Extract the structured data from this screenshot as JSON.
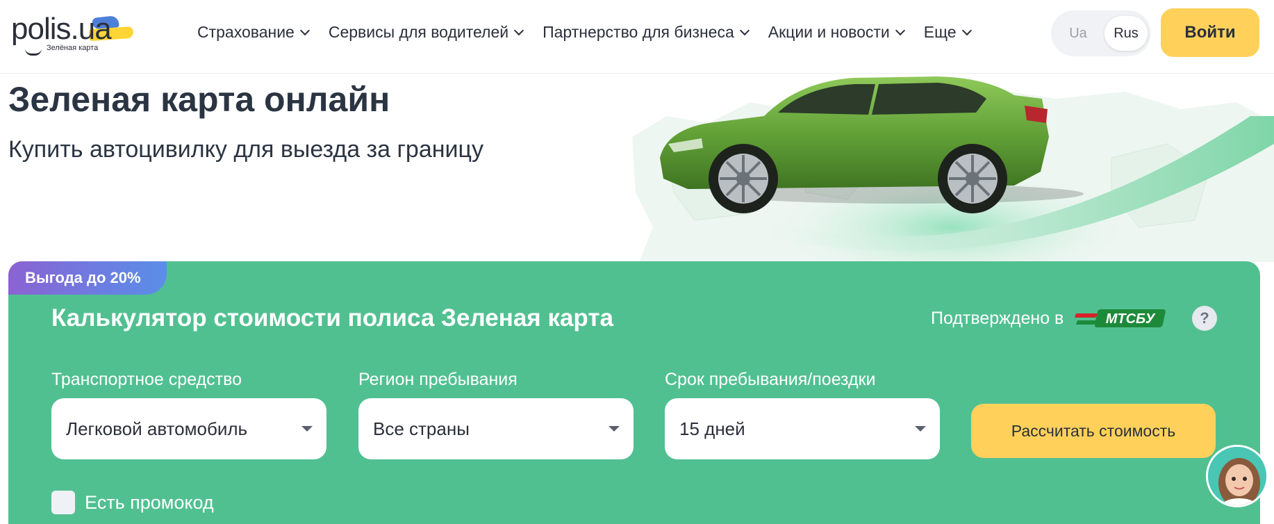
{
  "logo": {
    "brand_main": "polis",
    "brand_domain": ".ua",
    "subtitle": "Зелёная карта"
  },
  "nav": {
    "items": [
      {
        "label": "Страхование"
      },
      {
        "label": "Сервисы для водителей"
      },
      {
        "label": "Партнерство для бизнеса"
      },
      {
        "label": "Акции и новости"
      },
      {
        "label": "Еще"
      }
    ]
  },
  "lang": {
    "ua": "Ua",
    "rus": "Rus",
    "selected": "Rus"
  },
  "header": {
    "login_label": "Войти"
  },
  "hero": {
    "title": "Зеленая карта онлайн",
    "subtitle": "Купить автоцивилку для выезда за границу"
  },
  "calculator": {
    "badge": "Выгода до 20%",
    "title": "Калькулятор стоимости полиса Зеленая карта",
    "confirmed_text": "Подтверждено в",
    "confirmed_logo": "МТСБУ",
    "help_label": "?",
    "fields": [
      {
        "label": "Транспортное средство",
        "value": "Легковой автомобиль"
      },
      {
        "label": "Регион пребывания",
        "value": "Все страны"
      },
      {
        "label": "Срок пребывания/поездки",
        "value": "15 дней"
      }
    ],
    "submit_label": "Рассчитать стоимость",
    "promo_label": "Есть промокод",
    "promo_checked": false
  },
  "colors": {
    "accent_yellow": "#ffd15b",
    "calculator_green": "#51c091",
    "badge_purple": "#8c62d2",
    "badge_blue": "#5a8ee8",
    "text_dark": "#2b2f3a"
  },
  "icons": [
    "chevron-down-icon",
    "caret-down-icon",
    "help-icon",
    "mtsbu-logo",
    "chat-avatar"
  ]
}
